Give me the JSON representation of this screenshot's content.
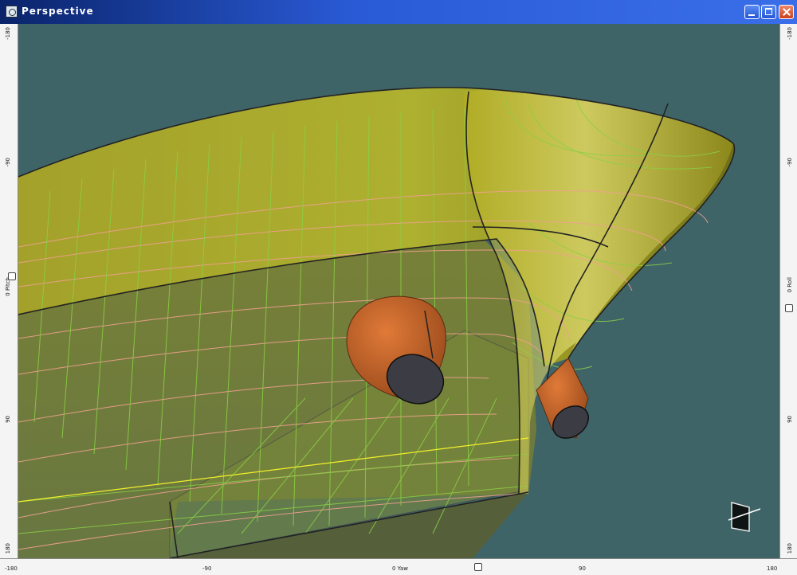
{
  "window": {
    "title": "Perspective"
  },
  "rulers": {
    "left": [
      "-180",
      "-90",
      "0 Pitch",
      "90",
      "180"
    ],
    "right": [
      "-180",
      "-90",
      "0 Roll",
      "90",
      "180"
    ],
    "bottom": [
      "-180",
      "-90",
      "0 Yaw",
      "90",
      "180"
    ]
  },
  "colors": {
    "background": "#3f6468",
    "hull": "#9c9a28",
    "bulb": "#c8602a",
    "section": "#f0a090",
    "waterline": "#8ad044"
  },
  "icons": {
    "app": "app-icon",
    "orientation": "view-orientation-icon"
  }
}
